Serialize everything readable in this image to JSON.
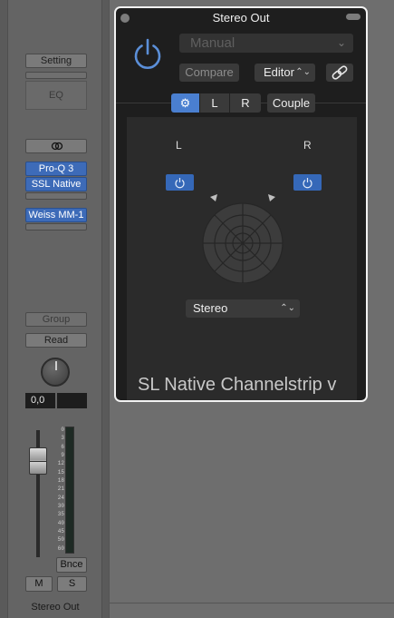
{
  "channel_strip": {
    "setting_label": "Setting",
    "eq_label": "EQ",
    "plugins": [
      "Pro-Q 3",
      "SSL Native",
      "Weiss MM-1"
    ],
    "group_label": "Group",
    "automation_mode": "Read",
    "pan_value": "0,0",
    "meter_scale": [
      "0",
      "3",
      "6",
      "9",
      "12",
      "15",
      "18",
      "21",
      "24",
      "30",
      "35",
      "40",
      "45",
      "50",
      "60"
    ],
    "bounce_label": "Bnce",
    "mute_label": "M",
    "solo_label": "S",
    "channel_name": "Stereo Out"
  },
  "plugin_window": {
    "title": "Stereo Out",
    "preset": "Manual",
    "compare_label": "Compare",
    "view_label": "Editor",
    "tabs": [
      {
        "label": "⚙",
        "active": true
      },
      {
        "label": "L",
        "active": false
      },
      {
        "label": "R",
        "active": false
      }
    ],
    "couple_label": "Couple",
    "left_label": "L",
    "right_label": "R",
    "mode": "Stereo",
    "plugin_name": "SL Native Channelstrip v"
  },
  "colors": {
    "accent_blue": "#3d6bb8",
    "power_blue": "#5b8fd8",
    "window_bg": "#1e1e1e",
    "panel_bg": "#2b2b2b"
  },
  "icons": [
    "power-icon",
    "link-icon",
    "gear-icon",
    "chevron-down-icon",
    "chevron-updown-icon",
    "stereo-link-icon"
  ]
}
